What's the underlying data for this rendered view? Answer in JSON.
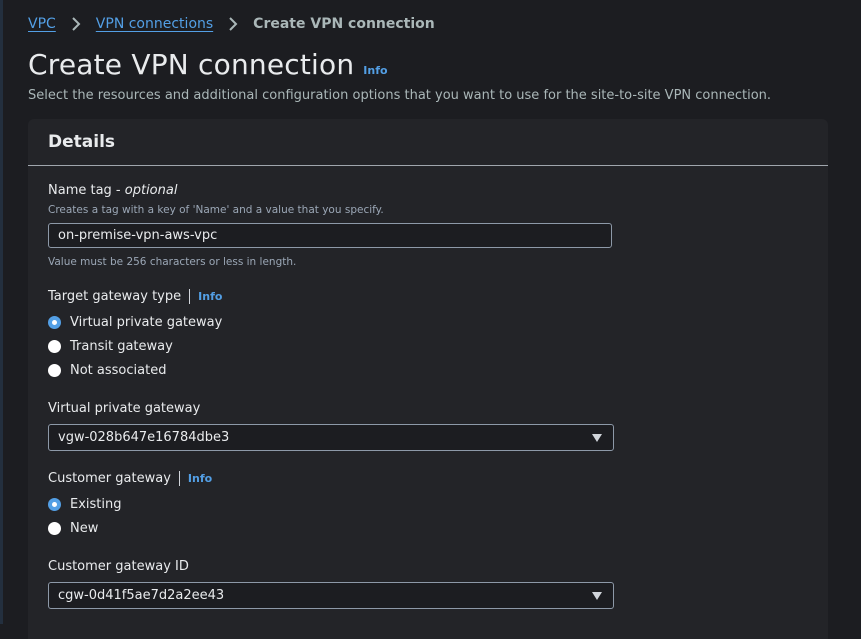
{
  "breadcrumb": {
    "root": "VPC",
    "parent": "VPN connections",
    "current": "Create VPN connection"
  },
  "header": {
    "title": "Create VPN connection",
    "info": "Info",
    "description": "Select the resources and additional configuration options that you want to use for the site-to-site VPN connection."
  },
  "details": {
    "title": "Details",
    "name_tag": {
      "label": "Name tag - ",
      "optional": "optional",
      "description": "Creates a tag with a key of 'Name' and a value that you specify.",
      "value": "on-premise-vpn-aws-vpc",
      "constraint": "Value must be 256 characters or less in length."
    },
    "target_gateway_type": {
      "label": "Target gateway type",
      "info": "Info",
      "options": [
        "Virtual private gateway",
        "Transit gateway",
        "Not associated"
      ],
      "selected": "Virtual private gateway"
    },
    "virtual_private_gateway": {
      "label": "Virtual private gateway",
      "value": "vgw-028b647e16784dbe3"
    },
    "customer_gateway": {
      "label": "Customer gateway",
      "info": "Info",
      "options": [
        "Existing",
        "New"
      ],
      "selected": "Existing"
    },
    "customer_gateway_id": {
      "label": "Customer gateway ID",
      "value": "cgw-0d41f5ae7d2a2ee43"
    }
  },
  "colors": {
    "accent": "#539fe5",
    "background": "#1c1d21",
    "panel": "#232428"
  }
}
